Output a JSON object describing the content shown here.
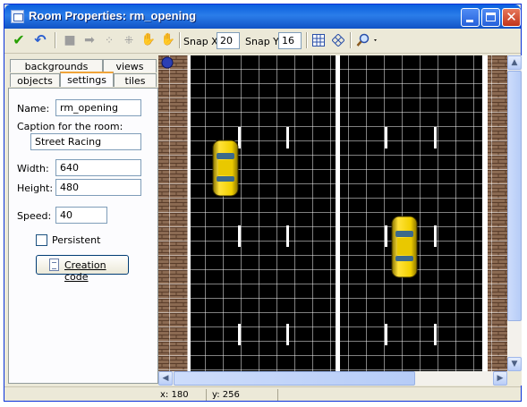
{
  "window": {
    "title": "Room Properties: rm_opening"
  },
  "toolbar": {
    "snap_x_label": "Snap X:",
    "snap_x_value": "20",
    "snap_y_label": "Snap Y:",
    "snap_y_value": "16"
  },
  "tabs": {
    "row1": [
      "backgrounds",
      "views"
    ],
    "row2": [
      "objects",
      "settings",
      "tiles"
    ],
    "active": "settings"
  },
  "settings": {
    "name_label": "Name:",
    "name_value": "rm_opening",
    "caption_label": "Caption for the room:",
    "caption_value": "Street Racing",
    "width_label": "Width:",
    "width_value": "640",
    "height_label": "Height:",
    "height_value": "480",
    "speed_label": "Speed:",
    "speed_value": "40",
    "persistent_label": "Persistent",
    "persistent_checked": false,
    "creation_code_label": "Creation code"
  },
  "status": {
    "x": "x: 180",
    "y": "y: 256"
  },
  "colors": {
    "title_bar": "#1153c6",
    "road": "#000000",
    "sidewalk": "#8b6a52",
    "car": "#f0d000"
  }
}
